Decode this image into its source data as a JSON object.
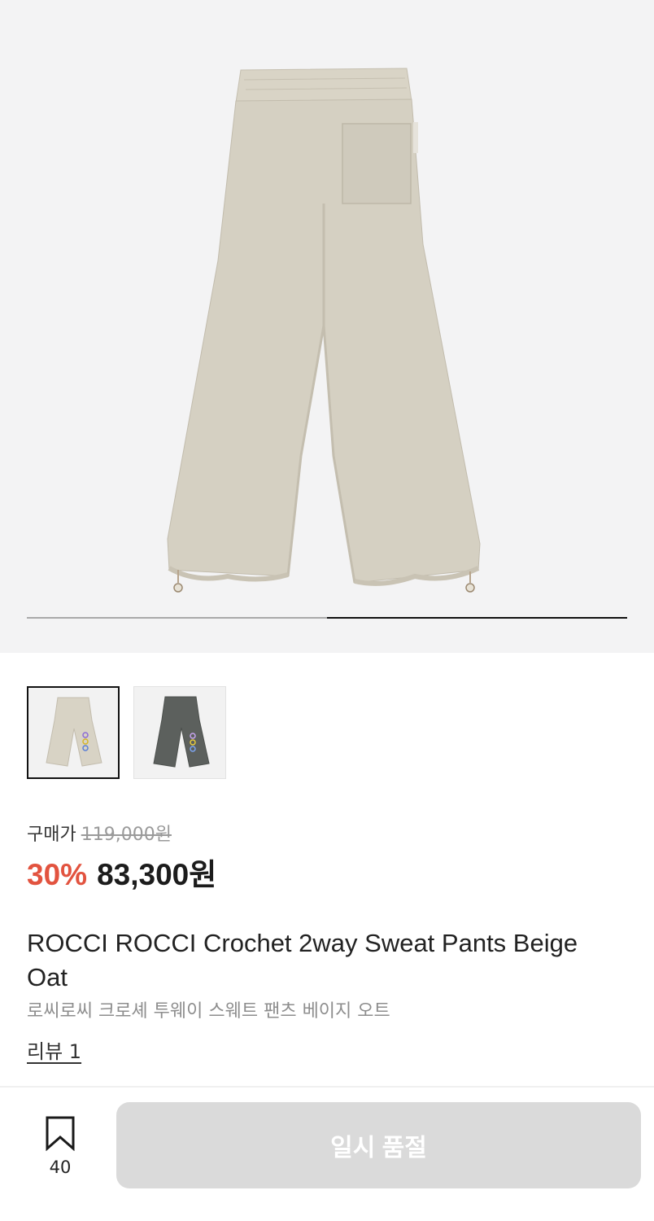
{
  "gallery": {
    "current_image": 2,
    "total_images": 2,
    "image_alt": "back view of beige oat wide sweat pants",
    "colors": {
      "background": "#f3f3f4",
      "pants": "#d4cfc1",
      "pants_shadow": "#bdb8aa"
    }
  },
  "thumbnails": [
    {
      "name": "beige-oat-variant",
      "color": "#d8d3c5",
      "selected": true
    },
    {
      "name": "charcoal-variant",
      "color": "#5c605d",
      "selected": false
    }
  ],
  "price": {
    "label": "구매가",
    "original": "119,000원",
    "discount": "30%",
    "sale": "83,300원"
  },
  "product": {
    "title": "ROCCI ROCCI Crochet 2way Sweat Pants Beige Oat",
    "subtitle": "로씨로씨 크로셰 투웨이 스웨트 팬츠 베이지 오트",
    "review_link": "리뷰 1"
  },
  "bottom_bar": {
    "bookmark_icon": "bookmark-icon",
    "bookmark_count": "40",
    "cta_label": "일시 품절"
  },
  "colors": {
    "discount": "#e2533f",
    "cta_disabled": "#dadada"
  }
}
